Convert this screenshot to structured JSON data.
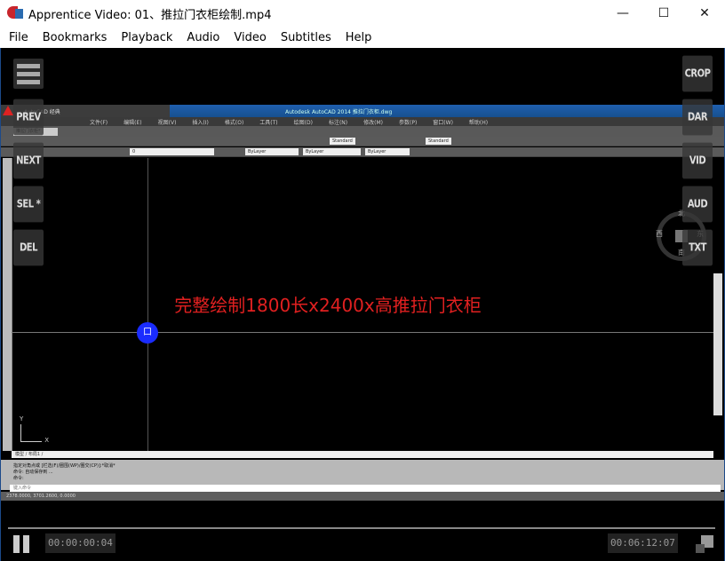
{
  "window": {
    "title": "Apprentice Video: 01、推拉门衣柜绘制.mp4",
    "minimize": "—",
    "maximize": "☐",
    "close": "✕"
  },
  "menu": [
    "File",
    "Bookmarks",
    "Playback",
    "Audio",
    "Video",
    "Subtitles",
    "Help"
  ],
  "overlay_left": [
    "PREV",
    "NEXT",
    "SEL *",
    "DEL"
  ],
  "overlay_right": [
    "CROP",
    "DAR",
    "VID",
    "AUD",
    "TXT"
  ],
  "video_frame": {
    "app_title": "Autodesk AutoCAD 2014  推拉门衣柜.dwg",
    "workspace": "AutoCAD 经典",
    "menus": [
      "文件(F)",
      "编辑(E)",
      "视图(V)",
      "插入(I)",
      "格式(O)",
      "工具(T)",
      "绘图(D)",
      "标注(N)",
      "修改(M)",
      "参数(P)",
      "窗口(W)",
      "帮助(H)"
    ],
    "doc_tab": "推拉门衣柜*",
    "style1": "Standard",
    "style2": "Standard",
    "layer": "0",
    "bylayer": [
      "ByLayer",
      "ByLayer",
      "ByLayer"
    ],
    "compass": {
      "n": "北",
      "s": "南",
      "e": "东",
      "w": "西"
    },
    "model_tabs": "模型 / 布局1 /",
    "cmd_lines": [
      "指定对角点或 [栏选(F)/圈围(WP)/圈交(CP)]:*取消*",
      "命令: 自动保存到 ...",
      "命令:"
    ],
    "cmd_placeholder": "键入命令",
    "coords": "2378.0000, 3701.2600, 0.0000",
    "subtitle": "完整绘制1800长x2400x高推拉门衣柜",
    "cursor_glyph": "口",
    "ucs_x": "X",
    "ucs_y": "Y"
  },
  "playback": {
    "current": "00:00:00:04",
    "total": "00:06:12:07",
    "progress": 0.0,
    "state": "playing"
  },
  "colors": {
    "subtitle": "#e02020",
    "cursor": "#1a2cff",
    "cad_title": "#1f5fae"
  }
}
